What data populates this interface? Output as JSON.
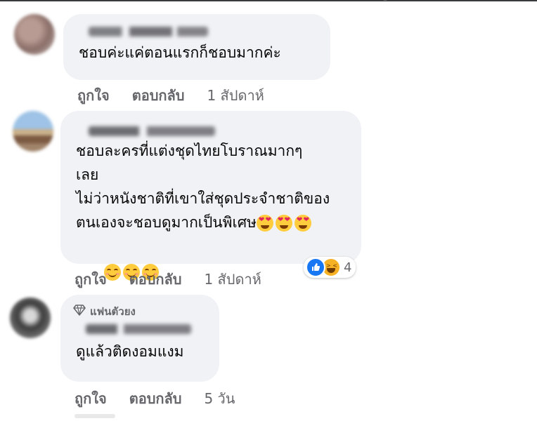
{
  "comments": [
    {
      "text": "ชอบค่ะแค่ตอนแรกก็ชอบมากค่ะ",
      "actions": {
        "like": "ถูกใจ",
        "reply": "ตอบกลับ",
        "time": "1 สัปดาห์"
      }
    },
    {
      "text_line1": "ชอบละครที่แต่งชุดไทยโบราณมากๆ",
      "text_line2": "เลย",
      "text_line3": "ไม่ว่าหนังชาติที่เขาใส่ชุดประจำชาติของ",
      "text_line4": "ตนเองจะชอบดูมากเป็นพิเศษ",
      "emojis_inline": [
        "smiling-face-with-heart-eyes",
        "smiling-face-with-heart-eyes",
        "smiling-face-with-heart-eyes"
      ],
      "emojis_line5": [
        "smiling-face-with-smiling-eyes",
        "smiling-face-with-smiling-eyes",
        "smiling-face-with-smiling-eyes"
      ],
      "reactions": {
        "icons": [
          "like",
          "haha"
        ],
        "count": "4"
      },
      "actions": {
        "like": "ถูกใจ",
        "reply": "ตอบกลับ",
        "time": "1 สัปดาห์"
      }
    },
    {
      "badge": "แฟนตัวยง",
      "badge_icon": "diamond-icon",
      "text": "ดูแล้วติดงอมแงม",
      "actions": {
        "like": "ถูกใจ",
        "reply": "ตอบกลับ",
        "time": "5 วัน"
      }
    }
  ],
  "colors": {
    "bubble": "#f0f2f5",
    "meta": "#65676b",
    "like": "#1877f2",
    "haha": "#f7b125"
  }
}
